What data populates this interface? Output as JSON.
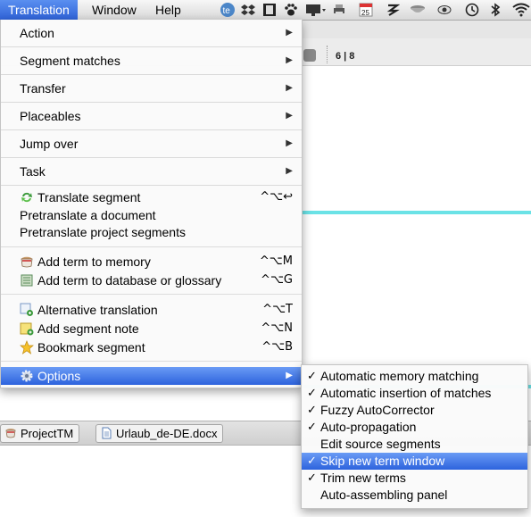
{
  "menubar": {
    "items": [
      {
        "label": "Translation"
      },
      {
        "label": "Window"
      },
      {
        "label": "Help"
      }
    ],
    "tray_icons": [
      "te-icon",
      "dropbox-icon",
      "film-icon",
      "paw-icon",
      "display-icon",
      "printer-icon",
      "calendar-icon",
      "brush-icon",
      "bowl-icon",
      "eye-icon",
      "time-machine-icon",
      "bluetooth-icon",
      "wifi-icon"
    ],
    "calendar_day": "25"
  },
  "window": {
    "segment_counter": "6 | 8"
  },
  "tabs": [
    {
      "label": "ProjectTM",
      "icon": "coffee-cup-icon"
    },
    {
      "label": "Urlaub_de-DE.docx",
      "icon": "document-icon"
    }
  ],
  "menu": {
    "submenus": [
      {
        "label": "Action"
      },
      {
        "label": "Segment matches"
      },
      {
        "label": "Transfer"
      },
      {
        "label": "Placeables"
      },
      {
        "label": "Jump over"
      },
      {
        "label": "Task"
      }
    ],
    "group1": [
      {
        "label": "Translate segment",
        "shortcut": "^⌥↩",
        "icon": "translate-arrows-icon"
      },
      {
        "label": "Pretranslate a document",
        "shortcut": ""
      },
      {
        "label": "Pretranslate project segments",
        "shortcut": ""
      }
    ],
    "group2": [
      {
        "label": "Add term to memory",
        "shortcut": "^⌥M",
        "icon": "memory-cup-icon"
      },
      {
        "label": "Add term to database or glossary",
        "shortcut": "^⌥G",
        "icon": "glossary-icon"
      }
    ],
    "group3": [
      {
        "label": "Alternative translation",
        "shortcut": "^⌥T",
        "icon": "alternative-icon"
      },
      {
        "label": "Add segment note",
        "shortcut": "^⌥N",
        "icon": "note-icon"
      },
      {
        "label": "Bookmark segment",
        "shortcut": "^⌥B",
        "icon": "star-icon"
      }
    ],
    "options": {
      "label": "Options",
      "icon": "gear-icon"
    }
  },
  "options_submenu": {
    "items": [
      {
        "label": "Automatic memory matching",
        "checked": "✓"
      },
      {
        "label": "Automatic insertion of matches",
        "checked": "✓"
      },
      {
        "label": "Fuzzy AutoCorrector",
        "checked": "✓"
      },
      {
        "label": "Auto-propagation",
        "checked": "✓"
      },
      {
        "label": "Edit source segments",
        "checked": ""
      },
      {
        "label": "Skip new term window",
        "checked": "✓"
      },
      {
        "label": "Trim new terms",
        "checked": "✓"
      },
      {
        "label": "Auto-assembling panel",
        "checked": ""
      }
    ]
  },
  "colors": {
    "highlight": "#3a6fe0",
    "accent_cyan": "#6be2e6"
  }
}
